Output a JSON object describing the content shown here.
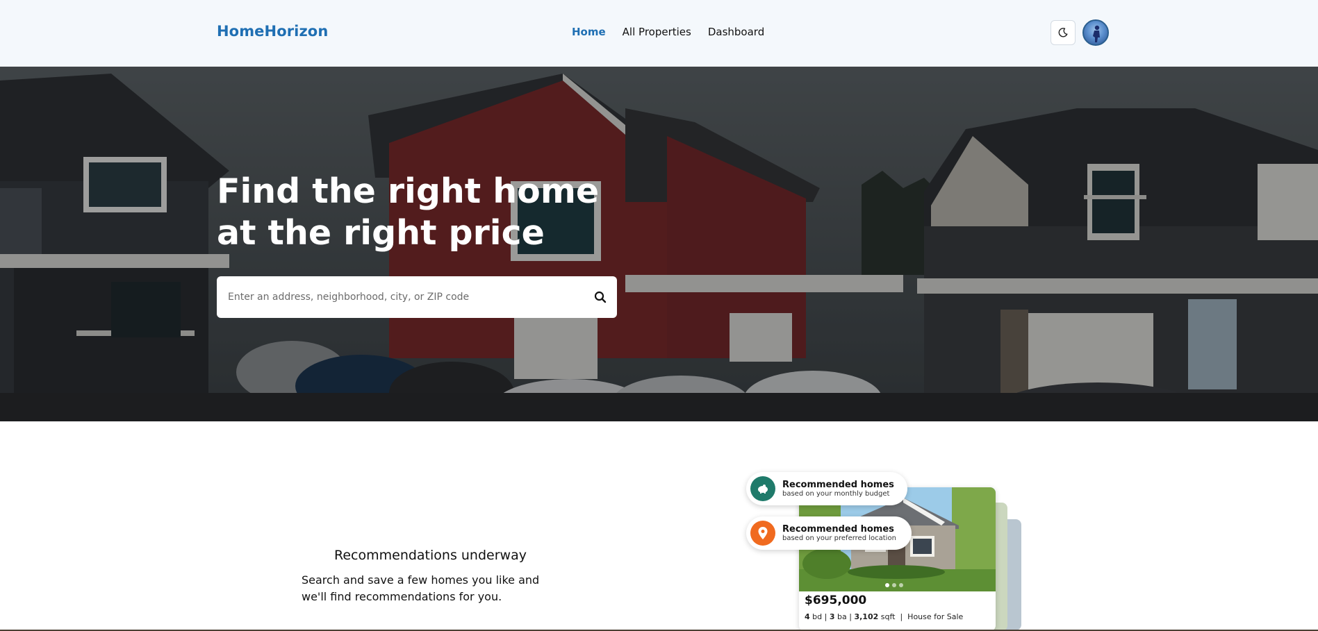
{
  "header": {
    "logo": "HomeHorizon",
    "nav": [
      {
        "label": "Home",
        "active": true
      },
      {
        "label": "All Properties",
        "active": false
      },
      {
        "label": "Dashboard",
        "active": false
      }
    ],
    "theme_icon": "moon-icon",
    "avatar_icon": "user-avatar"
  },
  "hero": {
    "title_line1": "Find the right home",
    "title_line2": "at the right price",
    "search_placeholder": "Enter an address, neighborhood, city, or ZIP code",
    "search_icon": "search-icon"
  },
  "recommendations": {
    "title": "Recommendations underway",
    "text": "Search and save a few homes you like and we'll find recommendations for you.",
    "pill_budget_title": "Recommended homes",
    "pill_budget_sub": "based on your monthly budget",
    "pill_location_title": "Recommended homes",
    "pill_location_sub": "based on your preferred location",
    "card": {
      "price": "$695,000",
      "beds": "4",
      "beds_unit": "bd",
      "baths": "3",
      "baths_unit": "ba",
      "sqft": "3,102",
      "sqft_unit": "sqft",
      "type": "House for Sale"
    }
  },
  "colors": {
    "brand": "#1f6fb3",
    "budget_circle": "#1f7a6a",
    "location_circle": "#f06a1f"
  }
}
